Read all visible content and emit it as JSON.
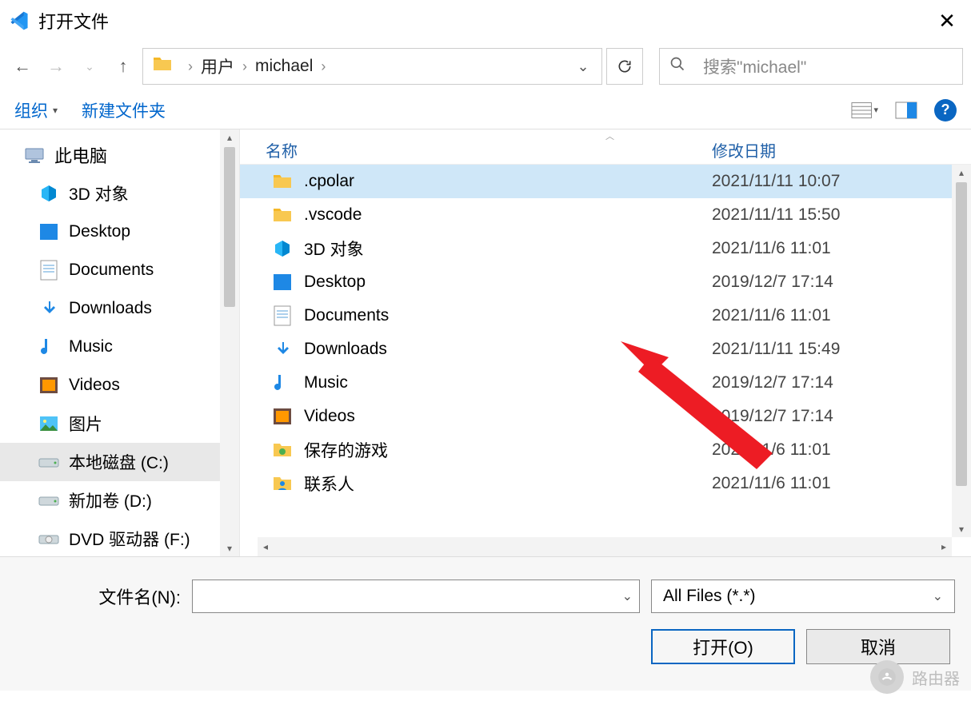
{
  "window": {
    "title": "打开文件"
  },
  "breadcrumb": {
    "crumb1": "用户",
    "crumb2": "michael"
  },
  "search": {
    "placeholder": "搜索\"michael\""
  },
  "toolbar": {
    "organize": "组织",
    "newfolder": "新建文件夹"
  },
  "columns": {
    "name": "名称",
    "modified": "修改日期"
  },
  "sidebar": {
    "items": [
      {
        "label": "此电脑",
        "icon": "pc"
      },
      {
        "label": "3D 对象",
        "icon": "3d"
      },
      {
        "label": "Desktop",
        "icon": "desktop"
      },
      {
        "label": "Documents",
        "icon": "documents"
      },
      {
        "label": "Downloads",
        "icon": "downloads"
      },
      {
        "label": "Music",
        "icon": "music"
      },
      {
        "label": "Videos",
        "icon": "videos"
      },
      {
        "label": "图片",
        "icon": "pictures"
      },
      {
        "label": "本地磁盘 (C:)",
        "icon": "disk",
        "selected": true
      },
      {
        "label": "新加卷 (D:)",
        "icon": "disk"
      },
      {
        "label": "DVD 驱动器 (F:)",
        "icon": "dvd"
      }
    ]
  },
  "files": [
    {
      "name": ".cpolar",
      "icon": "folder",
      "modified": "2021/11/11 10:07",
      "selected": true
    },
    {
      "name": ".vscode",
      "icon": "folder",
      "modified": "2021/11/11 15:50"
    },
    {
      "name": "3D 对象",
      "icon": "3d",
      "modified": "2021/11/6 11:01"
    },
    {
      "name": "Desktop",
      "icon": "desktop",
      "modified": "2019/12/7 17:14"
    },
    {
      "name": "Documents",
      "icon": "documents",
      "modified": "2021/11/6 11:01"
    },
    {
      "name": "Downloads",
      "icon": "downloads",
      "modified": "2021/11/11 15:49"
    },
    {
      "name": "Music",
      "icon": "music",
      "modified": "2019/12/7 17:14"
    },
    {
      "name": "Videos",
      "icon": "videos",
      "modified": "2019/12/7 17:14"
    },
    {
      "name": "保存的游戏",
      "icon": "games",
      "modified": "2021/11/6 11:01"
    },
    {
      "name": "联系人",
      "icon": "contacts",
      "modified": "2021/11/6 11:01"
    }
  ],
  "bottom": {
    "filename_label": "文件名(N):",
    "filename_value": "",
    "filter": "All Files (*.*)",
    "open": "打开(O)",
    "cancel": "取消"
  },
  "watermark": {
    "text": "路由器"
  }
}
